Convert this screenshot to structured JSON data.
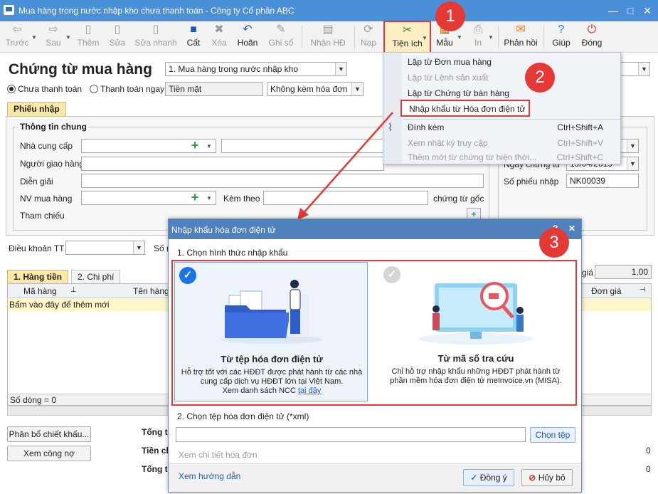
{
  "window": {
    "title": "Mua hàng trong nước nhập kho chưa thanh toán - Công ty Cổ phần ABC"
  },
  "toolbar": {
    "items": [
      {
        "label": "Trước",
        "icon": "arrow-left-icon"
      },
      {
        "label": "Sau",
        "icon": "arrow-right-icon"
      },
      {
        "label": "Thêm",
        "icon": "add-document-icon"
      },
      {
        "label": "Sửa",
        "icon": "edit-document-icon"
      },
      {
        "label": "Sửa nhanh",
        "icon": "quick-edit-icon"
      },
      {
        "label": "Cất",
        "icon": "save-icon"
      },
      {
        "label": "Xóa",
        "icon": "delete-icon"
      },
      {
        "label": "Hoãn",
        "icon": "undo-icon"
      },
      {
        "label": "Ghi sổ",
        "icon": "pencil-icon"
      },
      {
        "label": "Nhận HĐ",
        "icon": "receive-invoice-icon"
      },
      {
        "label": "Nạp",
        "icon": "reload-icon"
      },
      {
        "label": "Tiện ích",
        "icon": "tools-icon"
      },
      {
        "label": "Mẫu",
        "icon": "template-icon"
      },
      {
        "label": "In",
        "icon": "printer-icon"
      },
      {
        "label": "Phản hồi",
        "icon": "mail-icon"
      },
      {
        "label": "Giúp",
        "icon": "help-icon"
      },
      {
        "label": "Đóng",
        "icon": "close-app-icon"
      }
    ]
  },
  "form": {
    "title": "Chứng từ mua hàng",
    "doc_type": "1. Mua hàng trong nước nhập kho",
    "payment_unpaid": "Chưa thanh toán",
    "payment_immediate": "Thanh toán ngay",
    "payment_method": "Tiền mặt",
    "invoice_option": "Không kèm hóa đơn",
    "tab_receipt": "Phiếu nhập",
    "general_info": "Thông tin chung",
    "supplier": "Nhà cung cấp",
    "deliverer": "Người giao hàng",
    "description": "Diễn giải",
    "buyer": "NV mua hàng",
    "attach_label": "Kèm theo",
    "original_docs": "chứng từ gốc",
    "reference": "Tham chiếu",
    "date_label_partial": "Ngày chứng từ",
    "date_value_partial": "19/04/2019",
    "receipt_no_label": "Số phiếu nhập",
    "receipt_no": "NK00039",
    "payment_terms": "Điều khoản TT",
    "so_label": "Số n",
    "rate_label": "giá",
    "rate_value": "1,00"
  },
  "detail": {
    "tab_goods": "1. Hàng tiền",
    "tab_costs": "2. Chi phí",
    "col_code": "Mã hàng",
    "col_name": "Tên hàng",
    "col_price": "Đơn giá",
    "add_row": "Bấm vào đây để thêm mới",
    "row_count": "Số dòng = 0"
  },
  "footer": {
    "discount_btn": "Phân bổ chiết khấu...",
    "debt_btn": "Xem công nợ",
    "total1": "Tổng ti",
    "total2": "Tiền ch",
    "total3": "Tổng ti",
    "zero1": "0",
    "zero2": "0"
  },
  "menu": {
    "items": [
      {
        "label": "Lập từ Đơn mua hàng",
        "shortcut": "",
        "enabled": true
      },
      {
        "label": "Lập từ Lệnh sản xuất",
        "shortcut": "",
        "enabled": false
      },
      {
        "label": "Lập từ Chứng từ bán hàng",
        "shortcut": "",
        "enabled": true
      },
      {
        "label": "Nhập khẩu từ Hóa đơn điện tử",
        "shortcut": "",
        "enabled": true
      },
      {
        "label": "Đính kèm",
        "shortcut": "Ctrl+Shift+A",
        "enabled": true
      },
      {
        "label": "Xem nhật ký truy cập",
        "shortcut": "Ctrl+Shift+V",
        "enabled": false
      },
      {
        "label": "Thêm mới từ chứng từ hiện thời...",
        "shortcut": "Ctrl+Shift+C",
        "enabled": false
      }
    ]
  },
  "dialog": {
    "title": "Nhập khẩu hóa đơn điện tử",
    "step1": "1. Chọn hình thức nhập khẩu",
    "opt1_title": "Từ tệp hóa đơn điện tử",
    "opt1_desc": "Hỗ trợ tốt với các HĐĐT được phát hành từ các nhà cung cấp dịch vụ HĐĐT lớn tại Việt Nam.",
    "opt1_link_prefix": "Xem danh sách NCC ",
    "opt1_link": "tại đây",
    "opt2_title": "Từ mã số tra cứu",
    "opt2_desc": "Chỉ hỗ trợ nhập khẩu những HĐĐT phát hành từ phần mềm hóa đơn điện tử meInvoice.vn (MISA).",
    "step2": "2. Chọn tệp hóa đơn điện tử (*xml)",
    "choose_file": "Chọn tệp",
    "view_detail": "Xem chi tiết hóa đơn",
    "guide": "Xem hướng dẫn",
    "ok": "Đồng ý",
    "cancel": "Hủy bỏ"
  },
  "annotations": {
    "b1": "1",
    "b2": "2",
    "b3": "3"
  },
  "colors": {
    "title_bar": "#4a90d9",
    "highlight": "#e53935",
    "dialog_header": "#4f81bd",
    "tab_active": "#fbe7a6"
  }
}
